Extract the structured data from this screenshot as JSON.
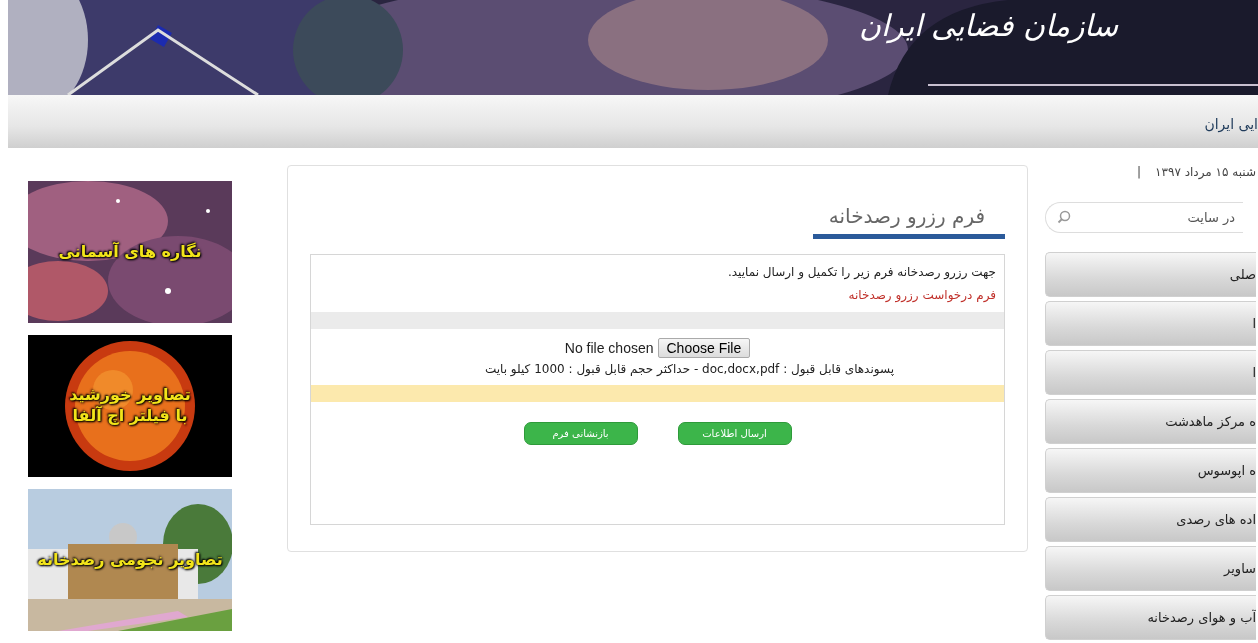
{
  "header": {
    "logo_text": "سازمان فضایی ایران"
  },
  "nav_bar": {
    "title": "ایی ایران"
  },
  "sidebar": {
    "date": "شنبه ۱۵ مرداد ۱۳۹۷",
    "separator": "|",
    "search": {
      "placeholder": "در سایت"
    },
    "menu": [
      {
        "label": "صلی"
      },
      {
        "label": "ا"
      },
      {
        "label": "ا"
      },
      {
        "label": "ه مرکز ماهدشت"
      },
      {
        "label": "ه اپوسوس"
      },
      {
        "label": "اده های رصدی"
      },
      {
        "label": "ساویر"
      },
      {
        "label": "آب و هوای رصدخانه"
      }
    ]
  },
  "form": {
    "title": "فرم رزرو رصدخانه",
    "intro": "جهت رزرو رصدخانه فرم زیر را تکمیل و ارسال نمایید.",
    "subtitle": "فرم درخواست رزرو رصدخانه",
    "file": {
      "status": "No file chosen",
      "button": "Choose File",
      "hint": "پسوندهای قابل قبول : doc,docx,pdf - حداکثر حجم قابل قبول : 1000 کیلو بایت"
    },
    "buttons": [
      "ارسال اطلاعات",
      "بازنشانی فرم"
    ]
  },
  "banners": [
    {
      "kind": "nebula",
      "lines": [
        "نگاره های آسمانی"
      ]
    },
    {
      "kind": "sun",
      "lines": [
        "تصاویر خورشید",
        "با فیلتر اچ آلفا"
      ]
    },
    {
      "kind": "building",
      "lines": [
        "تصاویر نجومی رصدخانه"
      ]
    }
  ]
}
